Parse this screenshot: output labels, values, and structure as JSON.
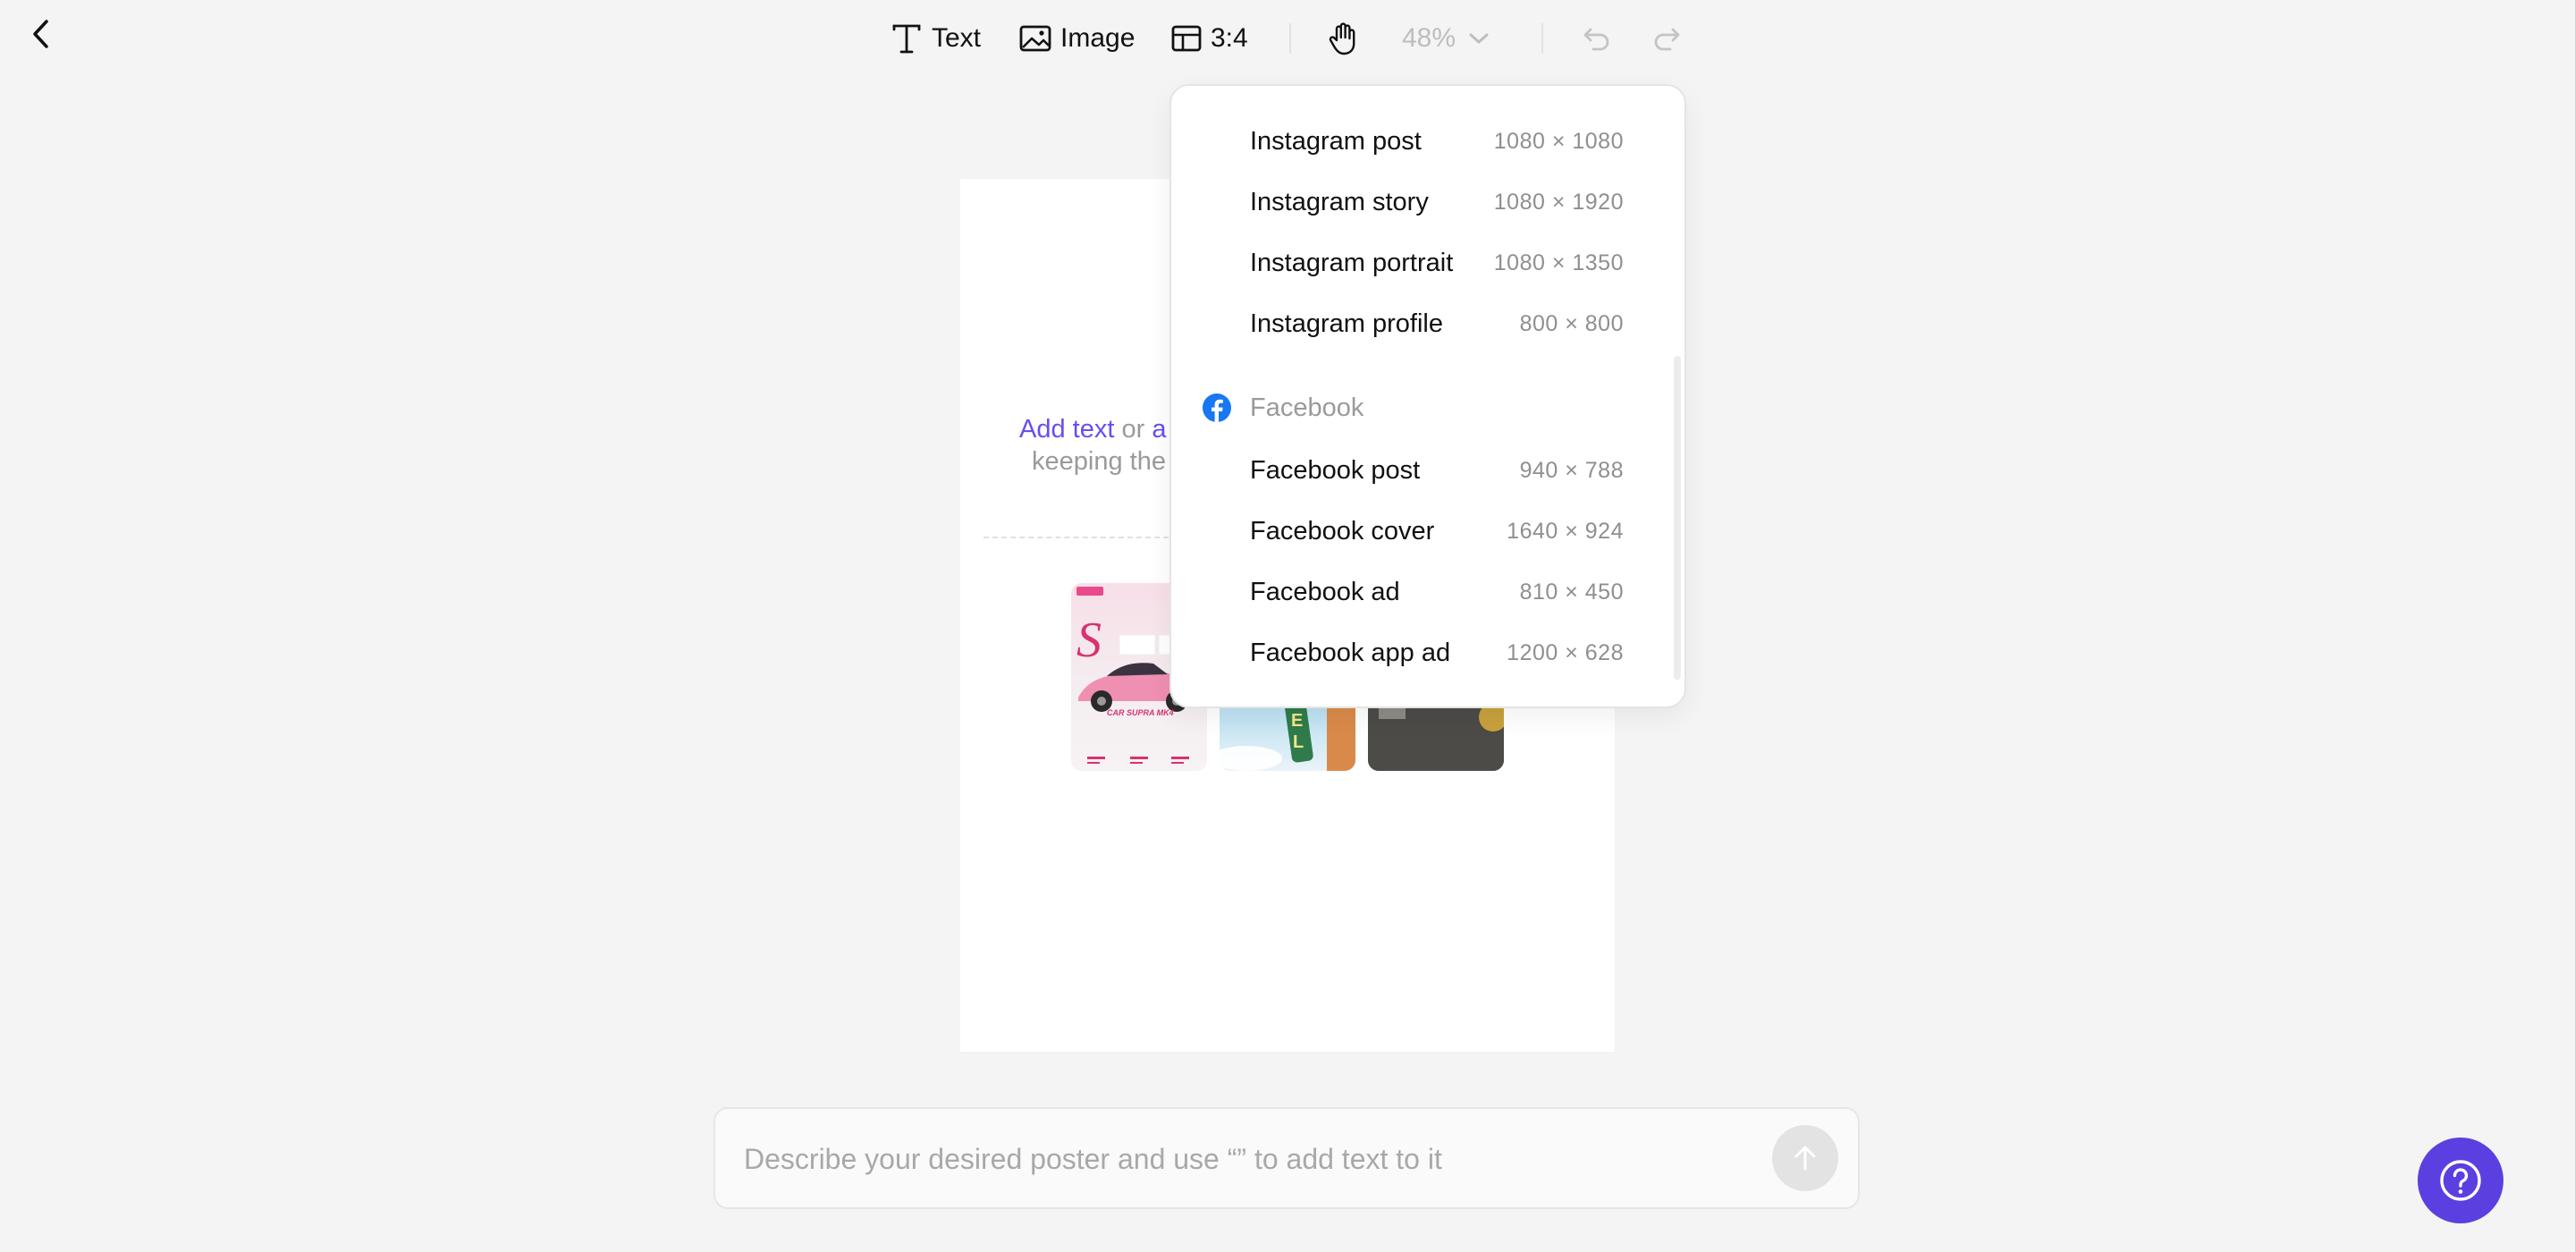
{
  "toolbar": {
    "text_label": "Text",
    "image_label": "Image",
    "ratio_label": "3:4",
    "zoom_label": "48%"
  },
  "canvas": {
    "hint_link1": "Add text",
    "hint_or": " or ",
    "hint_link2": "a",
    "hint_line2": "keeping the"
  },
  "thumbnails": [
    {
      "name": "car poster template"
    },
    {
      "name": "sign poster template"
    },
    {
      "name": "interior poster template"
    }
  ],
  "dropdown": {
    "instagram_items": [
      {
        "name": "Instagram post",
        "size": "1080 × 1080"
      },
      {
        "name": "Instagram story",
        "size": "1080 × 1920"
      },
      {
        "name": "Instagram portrait",
        "size": "1080 × 1350"
      },
      {
        "name": "Instagram profile",
        "size": "800 × 800"
      }
    ],
    "facebook_group": "Facebook",
    "facebook_items": [
      {
        "name": "Facebook post",
        "size": "940 × 788"
      },
      {
        "name": "Facebook cover",
        "size": "1640 × 924"
      },
      {
        "name": "Facebook ad",
        "size": "810 × 450"
      },
      {
        "name": "Facebook app ad",
        "size": "1200 × 628"
      }
    ]
  },
  "prompt": {
    "placeholder": "Describe your desired poster and use “” to add text to it"
  },
  "colors": {
    "accent": "#5c3fe0",
    "link": "#6a4cf0",
    "facebook": "#1877f2"
  }
}
